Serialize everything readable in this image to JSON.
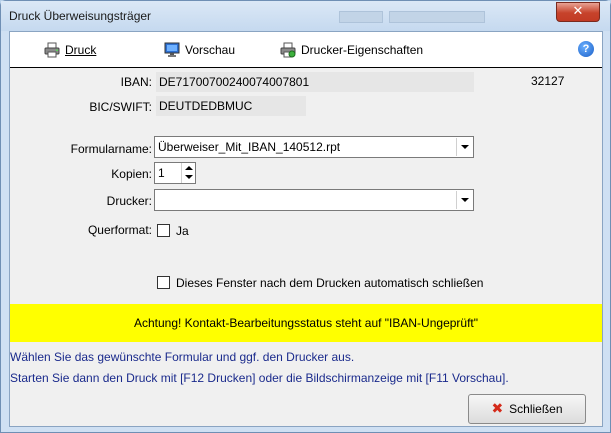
{
  "window": {
    "title": "Druck Überweisungsträger",
    "close_glyph": "✕"
  },
  "toolbar": {
    "print_label": "Druck",
    "preview_label": "Vorschau",
    "printer_props_label": "Drucker-Eigenschaften",
    "help_glyph": "?"
  },
  "account": {
    "iban_label": "IBAN:",
    "iban_value": "DE71700700240074007801",
    "bic_label": "BIC/SWIFT:",
    "bic_value": "DEUTDEDBMUC",
    "number": "32127"
  },
  "form": {
    "formname_label": "Formularname:",
    "formname_value": "Überweiser_Mit_IBAN_140512.rpt",
    "copies_label": "Kopien:",
    "copies_value": "1",
    "printer_label": "Drucker:",
    "printer_value": "",
    "landscape_label": "Querformat:",
    "landscape_option": "Ja",
    "landscape_checked": false,
    "autoclose_label": "Dieses Fenster nach dem Drucken automatisch schließen",
    "autoclose_checked": false
  },
  "warning": {
    "text": "Achtung! Kontakt-Bearbeitungsstatus steht auf \"IBAN-Ungeprüft\"",
    "color": "#ffff00"
  },
  "info": {
    "line1": "Wählen Sie das gewünschte Formular und ggf. den Drucker aus.",
    "line2": "Starten Sie dann den Druck mit [F12 Drucken] oder die Bildschirmanzeige mit [F11 Vorschau]."
  },
  "footer": {
    "close_label": "Schließen",
    "close_icon": "✖"
  },
  "icons": {
    "print": "printer-icon",
    "preview": "monitor-icon",
    "printer_props": "printer-settings-icon",
    "help": "help-icon",
    "close": "close-icon"
  }
}
